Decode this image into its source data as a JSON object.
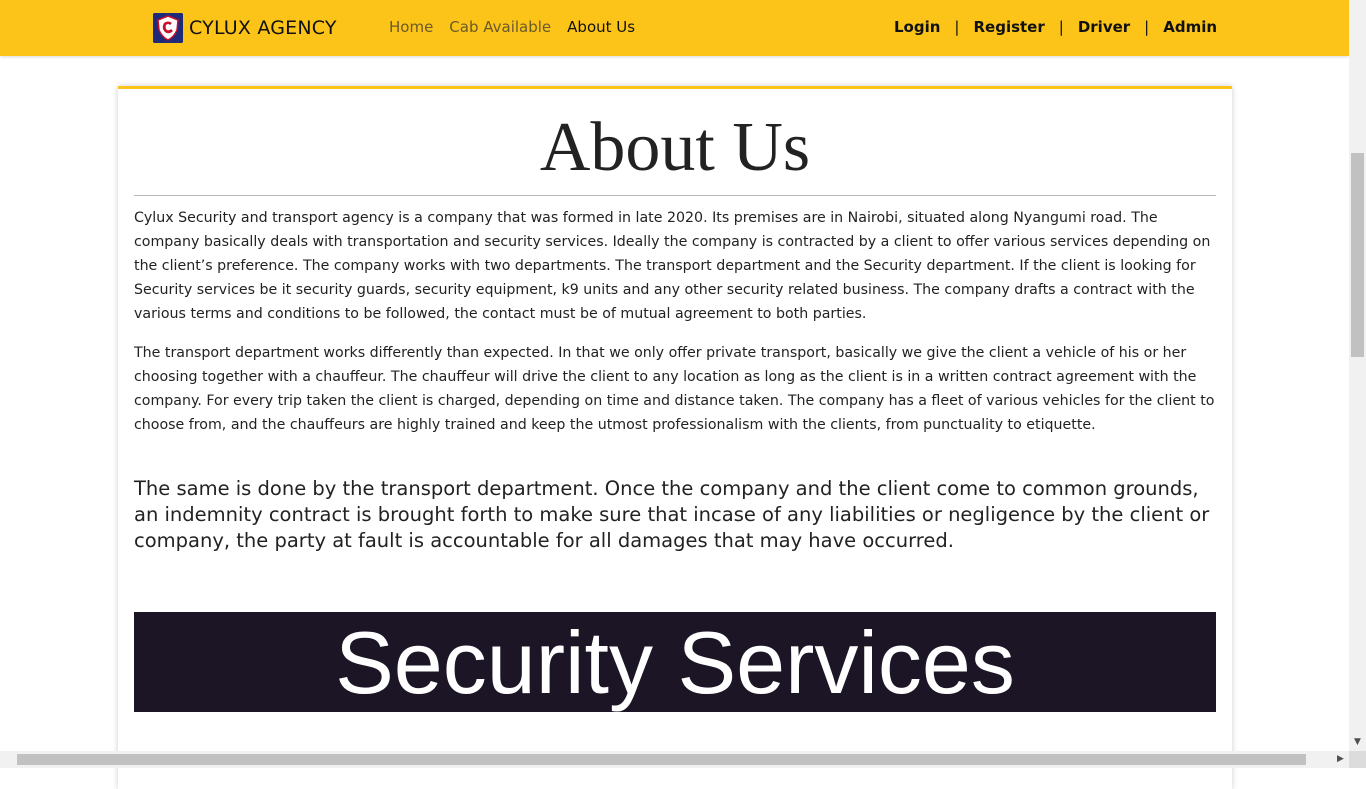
{
  "brand": {
    "name": "CYLUX AGENCY",
    "logo_icon": "shield-logo-icon"
  },
  "nav": {
    "links": [
      {
        "label": "Home",
        "active": false
      },
      {
        "label": "Cab Available",
        "active": false
      },
      {
        "label": "About Us",
        "active": true
      }
    ],
    "right": [
      "Login",
      "Register",
      "Driver",
      "Admin"
    ],
    "separator": "|"
  },
  "colors": {
    "accent": "#fcc419",
    "banner": "#1c1526"
  },
  "main": {
    "title": "About Us",
    "paragraphs": [
      "Cylux Security and transport agency is a company that was formed in late 2020. Its premises are in Nairobi, situated along Nyangumi road. The company basically deals with transportation and security services. Ideally the company is contracted by a client to offer various services depending on the client’s preference. The company works with two departments. The transport department and the Security department. If the client is looking for Security services be it security guards, security equipment, k9 units and any other security related business. The company drafts a contract with the various terms and conditions to be followed, the contact must be of mutual agreement to both parties.",
      "The transport department works differently than expected. In that we only offer private transport, basically we give the client a vehicle of his or her choosing together with a chauffeur. The chauffeur will drive the client to any location as long as the client is in a written contract agreement with the company. For every trip taken the client is charged, depending on time and distance taken. The company has a fleet of various vehicles for the client to choose from, and the chauffeurs are highly trained and keep the utmost professionalism with the clients, from punctuality to etiquette.",
      "The same is done by the transport department. Once the company and the client come to common grounds, an indemnity contract is brought forth to make sure that incase of any liabilities or negligence by the client or company, the party at fault is accountable for all damages that may have occurred."
    ],
    "banner": "Security Services"
  }
}
